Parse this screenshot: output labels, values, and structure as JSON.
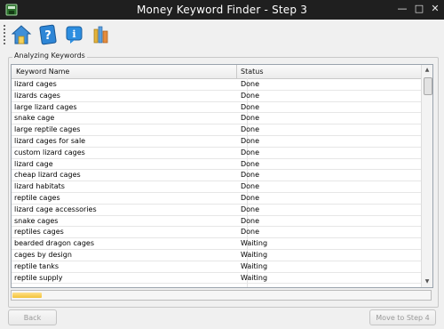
{
  "window": {
    "title": "Money Keyword Finder - Step 3",
    "controls": {
      "minimize": "—",
      "maximize": "□",
      "close": "✕"
    }
  },
  "toolbar": {
    "buttons": [
      {
        "icon": "home-icon"
      },
      {
        "icon": "help-book-icon"
      },
      {
        "icon": "info-icon"
      },
      {
        "icon": "books-icon"
      }
    ]
  },
  "group": {
    "label": "Analyzing Keywords"
  },
  "table": {
    "columns": [
      "Keyword Name",
      "Status"
    ],
    "rows": [
      [
        "lizard cages",
        "Done"
      ],
      [
        "lizards cages",
        "Done"
      ],
      [
        "large lizard cages",
        "Done"
      ],
      [
        "snake cage",
        "Done"
      ],
      [
        "large reptile cages",
        "Done"
      ],
      [
        "lizard cages for sale",
        "Done"
      ],
      [
        "custom lizard cages",
        "Done"
      ],
      [
        "lizard cage",
        "Done"
      ],
      [
        "cheap lizard cages",
        "Done"
      ],
      [
        "lizard habitats",
        "Done"
      ],
      [
        "reptile cages",
        "Done"
      ],
      [
        "lizard cage accessories",
        "Done"
      ],
      [
        "snake cages",
        "Done"
      ],
      [
        "reptiles cages",
        "Done"
      ],
      [
        "bearded dragon cages",
        "Waiting"
      ],
      [
        "cages by design",
        "Waiting"
      ],
      [
        "reptile tanks",
        "Waiting"
      ],
      [
        "reptile supply",
        "Waiting"
      ]
    ]
  },
  "progress": {
    "fraction": 0.07
  },
  "buttons": {
    "back": "Back",
    "next": "Move to Step 4"
  }
}
